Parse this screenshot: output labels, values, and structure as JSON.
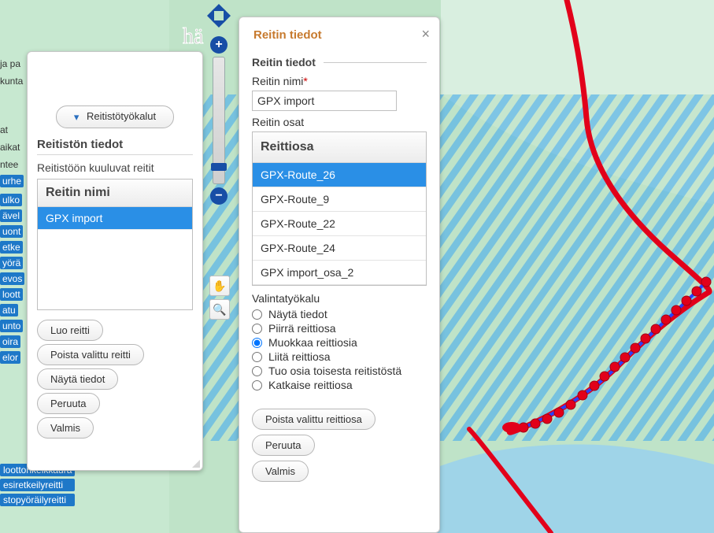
{
  "left_edge": {
    "frag1": "ja pa",
    "frag2": "kunta",
    "frag3": "at",
    "frag4": "aikat",
    "frag5": "ntee",
    "frag_tag_urhe": "urhe",
    "frag_tag_ulko": "ulko",
    "frag_tag_avel": "ävel",
    "frag_tag_uont": "uont",
    "frag_tag_etke": "etke",
    "frag_tag_yora": "yörä",
    "frag_tag_evos": "evos",
    "frag_tag_loott": "loott",
    "frag_tag_atu": "atu",
    "frag_tag_unto": "unto",
    "frag_tag_oira": "oira",
    "frag_tag_elor": "elor",
    "long1": "loottorikeikkaura",
    "long2": "esiretkeilyreitti",
    "long3": "stopyöräilyreitti"
  },
  "panel1": {
    "dropdown_label": "Reitistötyökalut",
    "section": "Reitistön tiedot",
    "list_label": "Reitistöön kuuluvat reitit",
    "list_header": "Reitin nimi",
    "rows": [
      "GPX import"
    ],
    "btn_create": "Luo reitti",
    "btn_delete": "Poista valittu reitti",
    "btn_show": "Näytä tiedot",
    "btn_cancel": "Peruuta",
    "btn_done": "Valmis"
  },
  "panel2": {
    "title": "Reitin tiedot",
    "legend": "Reitin tiedot",
    "name_label": "Reitin nimi",
    "name_value": "GPX import",
    "parts_label": "Reitin osat",
    "grid_header": "Reittiosa",
    "grid_rows": [
      "GPX-Route_26",
      "GPX-Route_9",
      "GPX-Route_22",
      "GPX-Route_24",
      "GPX import_osa_2"
    ],
    "tool_label": "Valintatyökalu",
    "radios": {
      "show": "Näytä tiedot",
      "draw": "Piirrä reittiosa",
      "edit": "Muokkaa reittiosia",
      "attach": "Liitä reittiosa",
      "import": "Tuo osia toisesta reitistöstä",
      "cut": "Katkaise reittiosa"
    },
    "selected_radio": "edit",
    "btn_delpart": "Poista valittu reittiosa",
    "btn_cancel": "Peruuta",
    "btn_done": "Valmis"
  },
  "colors": {
    "water": "#9fd4e8",
    "land": "#bfe3c8",
    "land2": "#d9efe0",
    "route": "#e2001a",
    "hatch": "#2a8fe6"
  }
}
